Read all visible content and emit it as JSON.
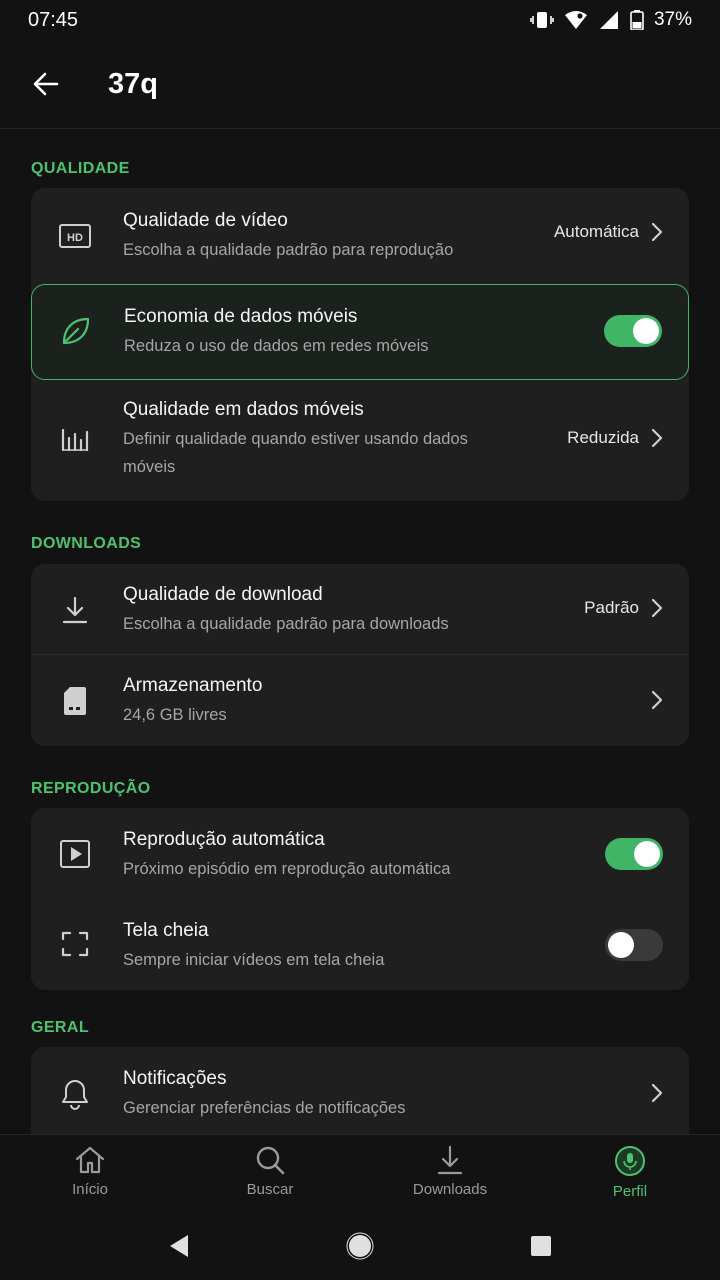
{
  "status": {
    "time": "07:45",
    "battery": "37%"
  },
  "header": {
    "title": "37q"
  },
  "sections": {
    "quality": {
      "label": "QUALIDADE",
      "video": {
        "title": "Qualidade de vídeo",
        "subtitle": "Escolha a qualidade padrão para reprodução",
        "value": "Automática",
        "icon": "hd-icon"
      },
      "data_saver": {
        "title": "Economia de dados móveis",
        "subtitle": "Reduza o uso de dados em redes móveis",
        "enabled": true,
        "icon": "leaf-icon"
      },
      "mobile_quality": {
        "title": "Qualidade em dados móveis",
        "subtitle": "Definir qualidade quando estiver usando dados móveis",
        "value": "Reduzida",
        "icon": "equalizer-icon"
      }
    },
    "downloads": {
      "label": "DOWNLOADS",
      "download_quality": {
        "title": "Qualidade de download",
        "subtitle": "Escolha a qualidade padrão para downloads",
        "value": "Padrão",
        "icon": "download-icon"
      },
      "storage": {
        "title": "Armazenamento",
        "subtitle": "24,6 GB livres",
        "icon": "sd-card-icon"
      }
    },
    "playback": {
      "label": "REPRODUÇÃO",
      "autoplay": {
        "title": "Reprodução automática",
        "subtitle": "Próximo episódio em reprodução automática",
        "enabled": true,
        "icon": "play-icon"
      },
      "fullscreen": {
        "title": "Tela cheia",
        "subtitle": "Sempre iniciar vídeos em tela cheia",
        "enabled": false,
        "icon": "fullscreen-icon"
      }
    },
    "general": {
      "label": "GERAL",
      "notifications": {
        "title": "Notificações",
        "subtitle": "Gerenciar preferências de notificações",
        "icon": "bell-icon"
      }
    }
  },
  "nav": {
    "home": "Início",
    "search": "Buscar",
    "downloads": "Downloads",
    "profile": "Perfil"
  },
  "colors": {
    "accent": "#3fb565",
    "background": "#121212",
    "card": "#1f1f1f"
  }
}
